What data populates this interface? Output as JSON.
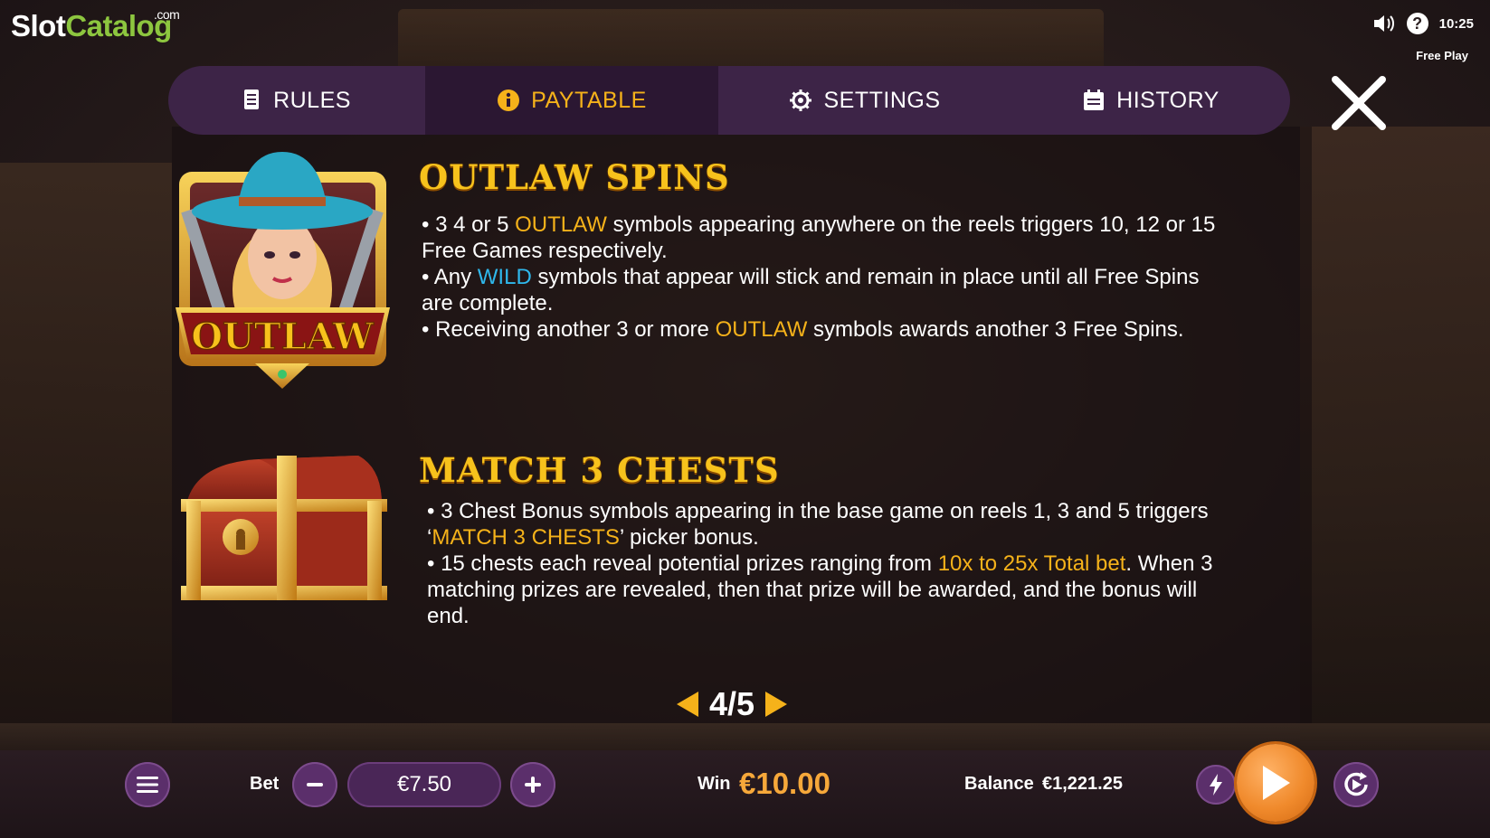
{
  "brand": {
    "slot": "Slot",
    "catalog": "Catalog",
    "dotcom": ".com"
  },
  "status": {
    "time": "10:25",
    "mode": "Free Play",
    "help": "?"
  },
  "tabs": {
    "rules": "RULES",
    "paytable": "PAYTABLE",
    "settings": "SETTINGS",
    "history": "HISTORY",
    "active": "PAYTABLE"
  },
  "symbols": {
    "outlaw_label": "OUTLAW"
  },
  "features": {
    "outlaw_spins": {
      "title": "OUTLAW SPINS",
      "b1_pre": "• 3 4 or 5 ",
      "b1_hl": "OUTLAW",
      "b1_post": " symbols appearing anywhere on the reels triggers 10, 12 or 15 Free Games respectively.",
      "b2_pre": "• Any ",
      "b2_hl": "WILD",
      "b2_post": " symbols that appear will stick and remain in place until all Free Spins are complete.",
      "b3_pre": "• Receiving another 3 or more ",
      "b3_hl": "OUTLAW",
      "b3_post": " symbols awards another 3 Free Spins."
    },
    "match_3_chests": {
      "title": "MATCH 3 CHESTS",
      "b1_pre": "• 3 Chest Bonus symbols appearing in the base game on reels 1, 3 and 5 triggers ‘",
      "b1_hl": "MATCH 3 CHESTS",
      "b1_post": "’ picker bonus.",
      "b2_pre": "• 15 chests each reveal potential prizes ranging from ",
      "b2_hl": "10x to 25x Total bet",
      "b2_post": ". When 3 matching prizes are revealed, then that prize will be awarded, and the bonus will end."
    }
  },
  "pagination": {
    "label": "4/5",
    "current": 4,
    "total": 5
  },
  "bottom": {
    "bet_label": "Bet",
    "bet_value": "€7.50",
    "win_label": "Win",
    "win_value": "€10.00",
    "balance_label": "Balance",
    "balance_value": "€1,221.25"
  },
  "colors": {
    "accent_gold": "#f5b21a",
    "wild_blue": "#2fb8ec",
    "tab_bg": "#3d2447",
    "spin_orange": "#f08a2c"
  },
  "icons": [
    "speaker-icon",
    "help-icon",
    "rules-doc-icon",
    "info-icon",
    "gear-icon",
    "history-icon",
    "close-icon",
    "menu-icon",
    "minus-icon",
    "plus-icon",
    "lightning-icon",
    "play-icon",
    "autoplay-icon"
  ]
}
